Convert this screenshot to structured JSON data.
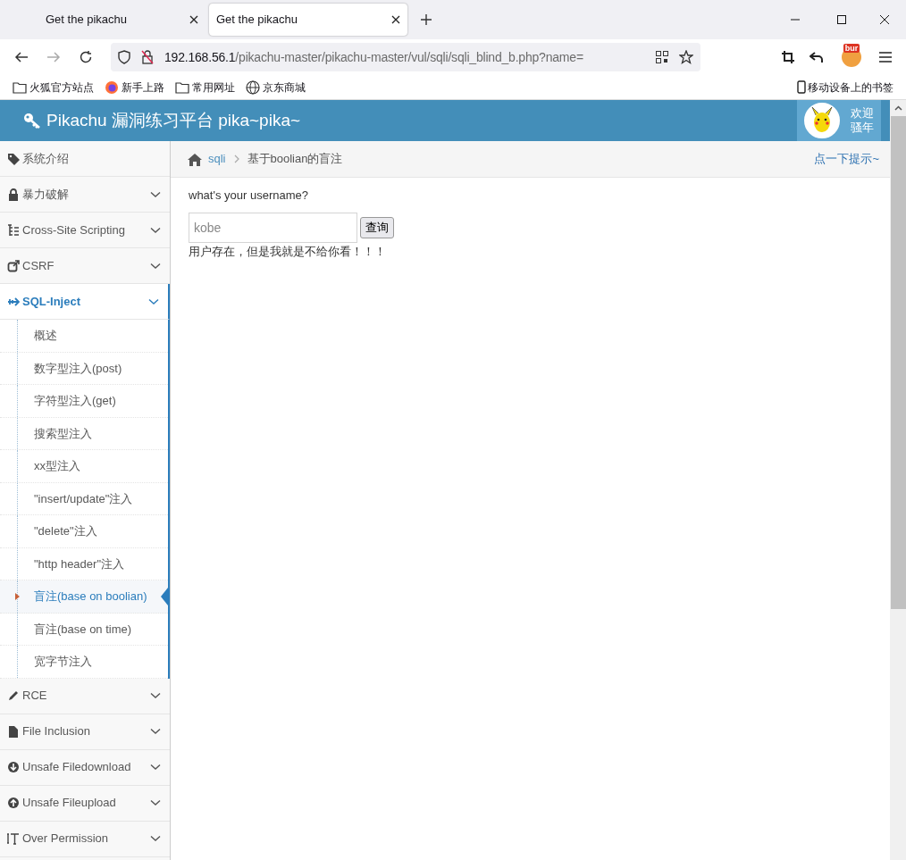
{
  "browser": {
    "tabs": [
      {
        "title": "Get the pikachu",
        "selected": false
      },
      {
        "title": "Get the pikachu",
        "selected": true
      }
    ],
    "address": {
      "host": "192.168.56.1",
      "path": "/pikachu-master/pikachu-master/vul/sqli/sqli_blind_b.php?name="
    },
    "bookmarks": [
      {
        "label": "火狐官方站点",
        "kind": "folder"
      },
      {
        "label": "新手上路",
        "kind": "firefox"
      },
      {
        "label": "常用网址",
        "kind": "folder"
      },
      {
        "label": "京东商城",
        "kind": "globe"
      }
    ],
    "mobile_bookmarks": "移动设备上的书签",
    "extension_badge": "bur"
  },
  "header": {
    "title": "Pikachu 漏洞练习平台 pika~pika~",
    "user_lines": [
      "欢迎",
      "骚年"
    ]
  },
  "sidebar": {
    "items": [
      {
        "label": "系统介绍",
        "expanded": false,
        "has_caret": false
      },
      {
        "label": "暴力破解",
        "expanded": false,
        "has_caret": true
      },
      {
        "label": "Cross-Site Scripting",
        "expanded": false,
        "has_caret": true
      },
      {
        "label": "CSRF",
        "expanded": false,
        "has_caret": true
      },
      {
        "label": "SQL-Inject",
        "expanded": true,
        "has_caret": true,
        "children": [
          {
            "label": "概述",
            "selected": false
          },
          {
            "label": "数字型注入(post)",
            "selected": false
          },
          {
            "label": "字符型注入(get)",
            "selected": false
          },
          {
            "label": "搜索型注入",
            "selected": false
          },
          {
            "label": "xx型注入",
            "selected": false
          },
          {
            "label": "\"insert/update\"注入",
            "selected": false
          },
          {
            "label": "\"delete\"注入",
            "selected": false
          },
          {
            "label": "\"http header\"注入",
            "selected": false
          },
          {
            "label": "盲注(base on boolian)",
            "selected": true
          },
          {
            "label": "盲注(base on time)",
            "selected": false
          },
          {
            "label": "宽字节注入",
            "selected": false
          }
        ]
      },
      {
        "label": "RCE",
        "expanded": false,
        "has_caret": true
      },
      {
        "label": "File Inclusion",
        "expanded": false,
        "has_caret": true
      },
      {
        "label": "Unsafe Filedownload",
        "expanded": false,
        "has_caret": true
      },
      {
        "label": "Unsafe Fileupload",
        "expanded": false,
        "has_caret": true
      },
      {
        "label": "Over Permission",
        "expanded": false,
        "has_caret": true
      }
    ]
  },
  "breadcrumb": {
    "items": [
      "sqli",
      "基于boolian的盲注"
    ],
    "hint": "点一下提示~"
  },
  "content": {
    "prompt": "what's your username?",
    "field": {
      "value": "kobe"
    },
    "button": "查询",
    "message": "用户存在，但是我就是不给你看！！！"
  }
}
